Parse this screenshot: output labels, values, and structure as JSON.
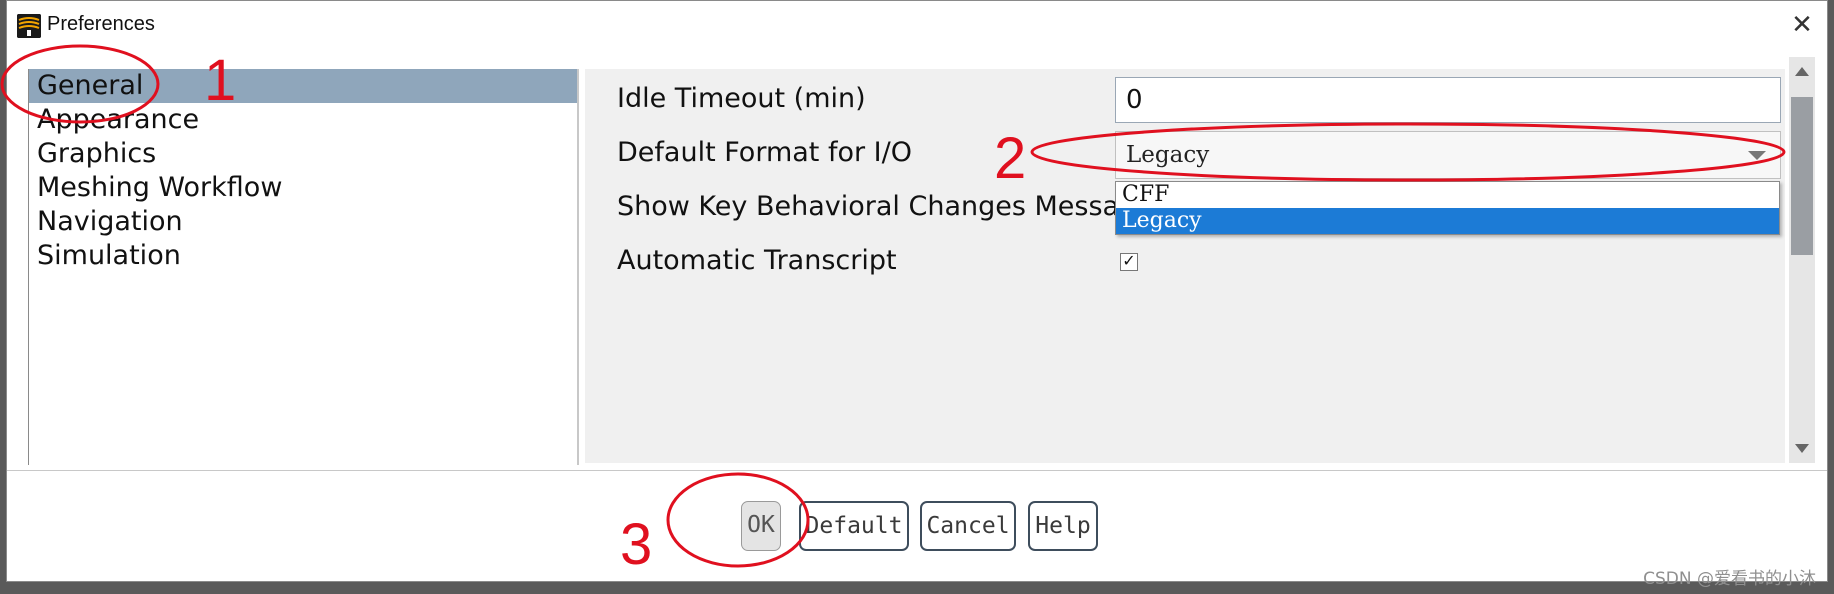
{
  "window": {
    "title": "Preferences",
    "close_glyph": "✕"
  },
  "nav": {
    "items": [
      {
        "label": "General",
        "selected": true
      },
      {
        "label": "Appearance",
        "selected": false
      },
      {
        "label": "Graphics",
        "selected": false
      },
      {
        "label": "Meshing Workflow",
        "selected": false
      },
      {
        "label": "Navigation",
        "selected": false
      },
      {
        "label": "Simulation",
        "selected": false
      }
    ],
    "selected_color": "#8fa6bb"
  },
  "settings": {
    "idle_timeout": {
      "label": "Idle Timeout (min)",
      "value": "0"
    },
    "default_format": {
      "label": "Default Format for I/O",
      "value": "Legacy"
    },
    "key_changes": {
      "label": "Show Key Behavioral Changes Message"
    },
    "auto_transcript": {
      "label": "Automatic Transcript",
      "checked": true,
      "check_glyph": "✓"
    }
  },
  "dropdown": {
    "options": [
      {
        "label": "CFF",
        "highlighted": false
      },
      {
        "label": "Legacy",
        "highlighted": true
      }
    ],
    "highlight_color": "#1c7bd6"
  },
  "buttons": {
    "ok": "OK",
    "default": "Default",
    "cancel": "Cancel",
    "help": "Help"
  },
  "annotations": {
    "one": "1",
    "two": "2",
    "three": "3",
    "color": "#e0101f"
  },
  "watermark": "CSDN @爱看书的小沐"
}
